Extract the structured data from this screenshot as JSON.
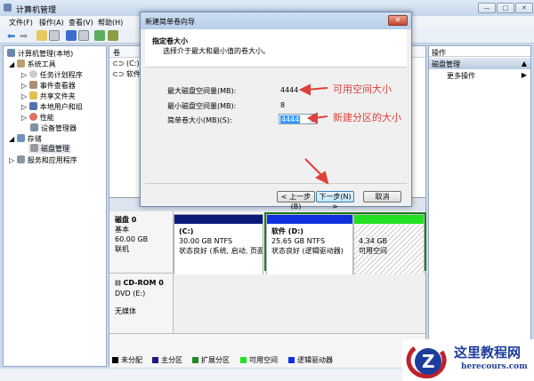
{
  "window": {
    "title": "计算机管理",
    "min": "—",
    "max": "□",
    "close": "✕"
  },
  "menu": [
    "文件(F)",
    "操作(A)",
    "查看(V)",
    "帮助(H)"
  ],
  "tree": {
    "root": "计算机管理(本地)",
    "system_tools": "系统工具",
    "task_scheduler": "任务计划程序",
    "event_viewer": "事件查看器",
    "shared_folders": "共享文件夹",
    "local_users": "本地用户和组",
    "performance": "性能",
    "device_manager": "设备管理器",
    "storage": "存储",
    "disk_management": "磁盘管理",
    "services": "服务和应用程序"
  },
  "volume_list": {
    "header": "卷",
    "rows": [
      "(C:)",
      "软件 (D:"
    ]
  },
  "actions": {
    "header": "操作",
    "section": "磁盘管理",
    "more": "更多操作"
  },
  "dialog": {
    "title": "新建简单卷向导",
    "heading": "指定卷大小",
    "subheading": "选择介于最大和最小值的卷大小。",
    "max_label": "最大磁盘空间量(MB):",
    "max_value": "4444",
    "min_label": "最小磁盘空间量(MB):",
    "min_value": "8",
    "size_label": "简单卷大小(MB)(S):",
    "size_value": "4444",
    "back": "< 上一步(B)",
    "next": "下一步(N) >",
    "cancel": "取消"
  },
  "annotations": {
    "available": "可用空间大小",
    "new_size": "新建分区的大小"
  },
  "disk0": {
    "name": "磁盘 0",
    "type": "基本",
    "size": "60.00 GB",
    "status": "联机",
    "partitions": [
      {
        "name": "(C:)",
        "size": "30.00 GB NTFS",
        "status": "状态良好 (系统, 启动, 页面文"
      },
      {
        "name": "软件 (D:)",
        "size": "25.65 GB NTFS",
        "status": "状态良好 (逻辑驱动器)"
      },
      {
        "size": "4.34 GB",
        "status": "可用空间"
      }
    ]
  },
  "cdrom": {
    "name": "CD-ROM 0",
    "type": "DVD (E:)",
    "status": "无媒体"
  },
  "legend": [
    {
      "label": "未分配",
      "color": "#000000"
    },
    {
      "label": "主分区",
      "color": "#1a1a80"
    },
    {
      "label": "扩展分区",
      "color": "#1f8a1f"
    },
    {
      "label": "可用空间",
      "color": "#22e022"
    },
    {
      "label": "逻辑驱动器",
      "color": "#1030e0"
    }
  ],
  "watermark": {
    "name": "这里教程网",
    "url": "herecours.com"
  }
}
